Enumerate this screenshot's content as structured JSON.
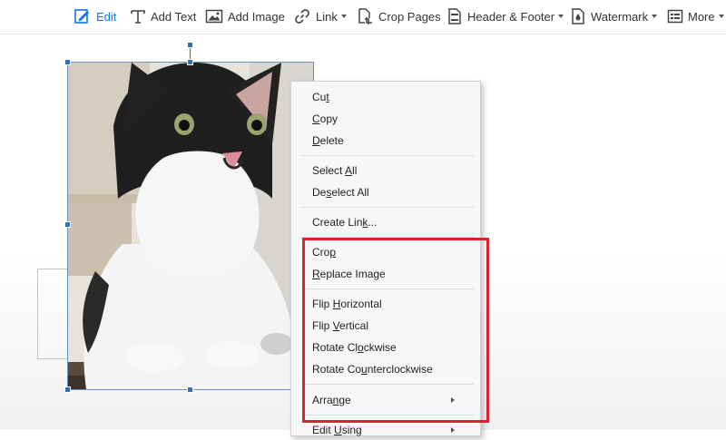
{
  "toolbar": {
    "items": [
      {
        "label": "Edit",
        "icon": "edit-icon",
        "active": true
      },
      {
        "label": "Add Text",
        "icon": "text-icon"
      },
      {
        "label": "Add Image",
        "icon": "image-icon"
      },
      {
        "label": "Link",
        "icon": "link-icon",
        "dropdown": true
      },
      {
        "label": "Crop Pages",
        "icon": "crop-icon"
      },
      {
        "label": "Header & Footer",
        "icon": "header-footer-icon",
        "dropdown": true
      },
      {
        "label": "Watermark",
        "icon": "watermark-icon",
        "dropdown": true
      },
      {
        "label": "More",
        "icon": "more-icon",
        "dropdown": true
      }
    ]
  },
  "context_menu": {
    "items": [
      {
        "pre": "Cu",
        "key": "t",
        "post": ""
      },
      {
        "pre": "",
        "key": "C",
        "post": "opy"
      },
      {
        "pre": "",
        "key": "D",
        "post": "elete"
      },
      {
        "pre": "Select ",
        "key": "A",
        "post": "ll"
      },
      {
        "pre": "De",
        "key": "s",
        "post": "elect All"
      },
      {
        "pre": "Create Lin",
        "key": "k",
        "post": "..."
      },
      {
        "pre": "Cro",
        "key": "p",
        "post": ""
      },
      {
        "pre": "",
        "key": "R",
        "post": "eplace Image"
      },
      {
        "pre": "Flip ",
        "key": "H",
        "post": "orizontal"
      },
      {
        "pre": "Flip ",
        "key": "V",
        "post": "ertical"
      },
      {
        "pre": "Rotate Cl",
        "key": "o",
        "post": "ckwise"
      },
      {
        "pre": "Rotate Co",
        "key": "u",
        "post": "nterclockwise"
      },
      {
        "pre": "Arra",
        "key": "n",
        "post": "ge"
      },
      {
        "pre": "Edit ",
        "key": "U",
        "post": "sing"
      }
    ]
  },
  "colors": {
    "accent": "#1473e6",
    "highlight": "#d9232f",
    "selection": "#2f6fb6"
  }
}
